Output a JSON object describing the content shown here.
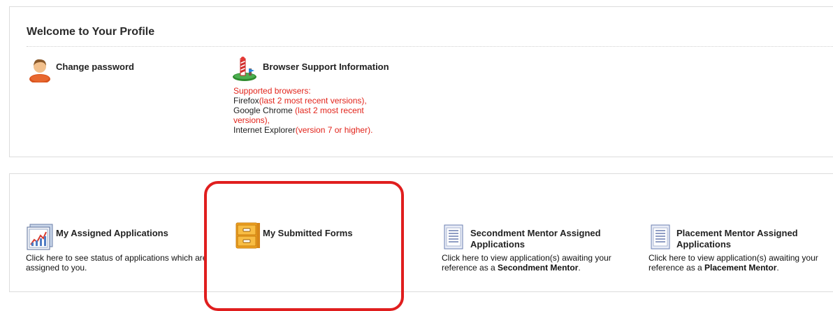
{
  "profile": {
    "title": "Welcome to Your Profile",
    "change_password": "Change password",
    "browser_support": {
      "title": "Browser Support Information",
      "supported_label": "Supported browsers:",
      "firefox_name": "Firefox",
      "firefox_note": "(last 2 most recent versions),",
      "chrome_name": "Google Chrome ",
      "chrome_note": "(last 2 most recent versions),",
      "ie_name": "Internet Explorer",
      "ie_note": "(version 7 or higher)."
    }
  },
  "apps": {
    "assigned": {
      "title": "My Assigned Applications",
      "desc": "Click here to see status of applications which are assigned to you."
    },
    "submitted": {
      "title": "My Submitted Forms"
    },
    "secondment": {
      "title": "Secondment Mentor Assigned Applications",
      "desc_prefix": "Click here to view application(s) awaiting your reference as a ",
      "desc_bold": "Secondment Mentor",
      "desc_suffix": "."
    },
    "placement": {
      "title": "Placement Mentor Assigned Applications",
      "desc_prefix": "Click here to view application(s) awaiting your reference as a ",
      "desc_bold": "Placement Mentor",
      "desc_suffix": "."
    }
  },
  "colors": {
    "highlight": "#e01e1e",
    "note_red": "#e2231a"
  }
}
